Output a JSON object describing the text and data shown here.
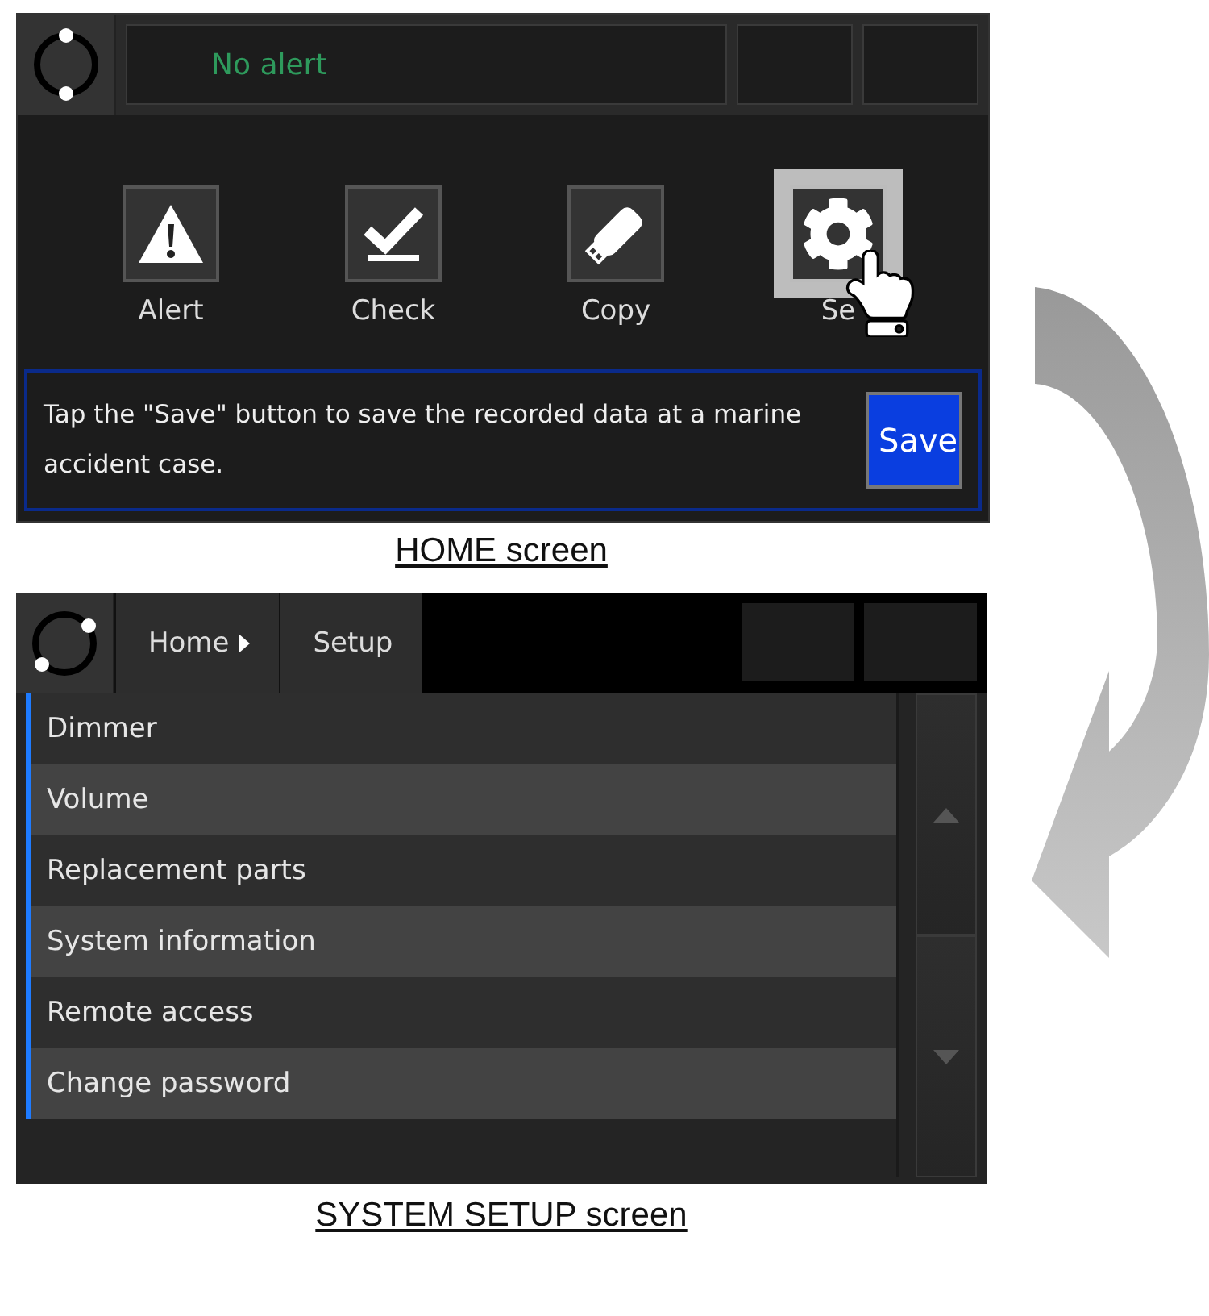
{
  "home_screen": {
    "alert_text": "No alert",
    "apps": [
      {
        "kind": "alert",
        "label": "Alert",
        "selected": false
      },
      {
        "kind": "check",
        "label": "Check",
        "selected": false
      },
      {
        "kind": "copy",
        "label": "Copy",
        "selected": false
      },
      {
        "kind": "setup",
        "label": "Se",
        "selected": true
      }
    ],
    "message": "Tap the \"Save\" button to save the recorded data at a marine accident case.",
    "save_button": "Save"
  },
  "home_caption": "HOME screen",
  "setup_screen": {
    "breadcrumb": [
      "Home",
      "Setup"
    ],
    "items": [
      {
        "label": "Dimmer"
      },
      {
        "label": "Volume"
      },
      {
        "label": "Replacement parts"
      },
      {
        "label": "System information"
      },
      {
        "label": "Remote access"
      },
      {
        "label": "Change password"
      }
    ]
  },
  "setup_caption": "SYSTEM SETUP screen"
}
